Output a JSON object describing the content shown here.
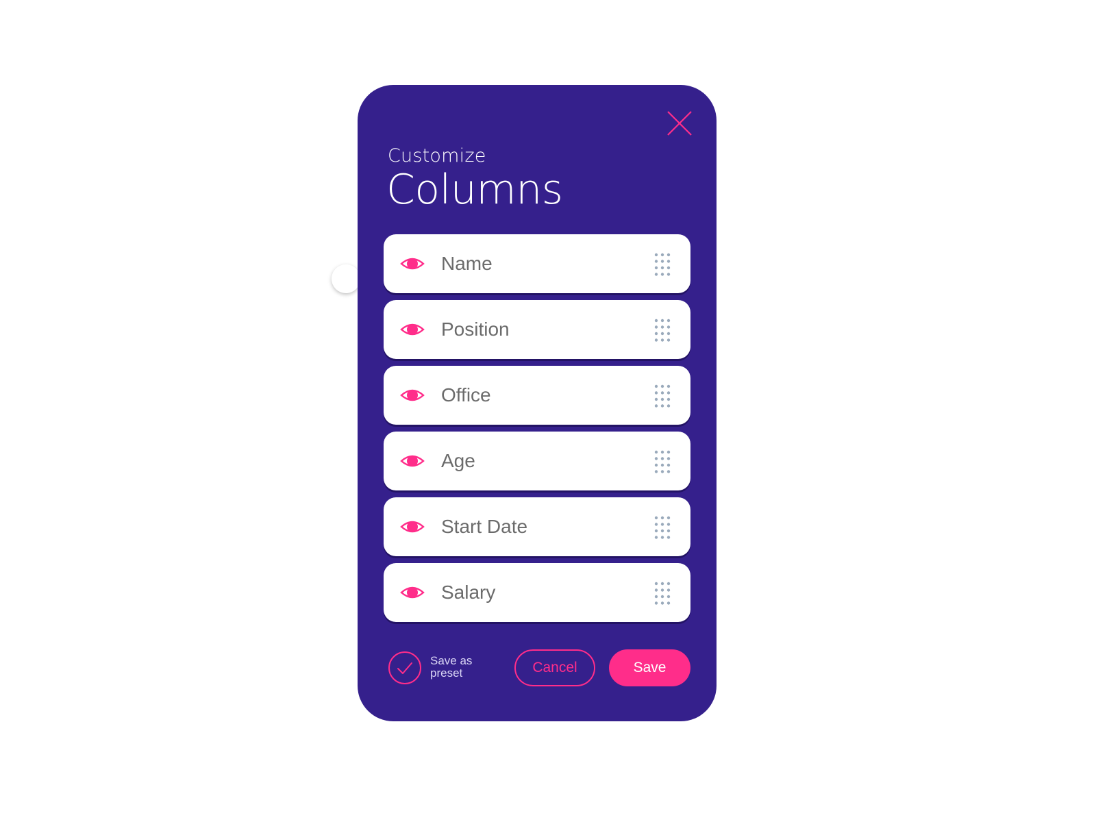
{
  "dialog": {
    "title_small": "Customize",
    "title_big": "Columns",
    "close_icon": "close-icon"
  },
  "columns": [
    {
      "label": "Name",
      "visible": true,
      "icon": "eye-icon",
      "handle_icon": "drag-handle-icon"
    },
    {
      "label": "Position",
      "visible": true,
      "icon": "eye-icon",
      "handle_icon": "drag-handle-icon"
    },
    {
      "label": "Office",
      "visible": true,
      "icon": "eye-icon",
      "handle_icon": "drag-handle-icon"
    },
    {
      "label": "Age",
      "visible": true,
      "icon": "eye-icon",
      "handle_icon": "drag-handle-icon"
    },
    {
      "label": "Start Date",
      "visible": true,
      "icon": "eye-icon",
      "handle_icon": "drag-handle-icon"
    },
    {
      "label": "Salary",
      "visible": true,
      "icon": "eye-icon",
      "handle_icon": "drag-handle-icon"
    }
  ],
  "footer": {
    "save_preset_label": "Save as preset",
    "save_preset_checked": true,
    "cancel_label": "Cancel",
    "save_label": "Save"
  },
  "colors": {
    "panel_bg": "#35208c",
    "accent": "#ff2d8a",
    "row_bg": "#ffffff",
    "row_text": "#6b6b6b",
    "handle_dots": "#9aaabb",
    "page_bg": "#ffffff"
  }
}
